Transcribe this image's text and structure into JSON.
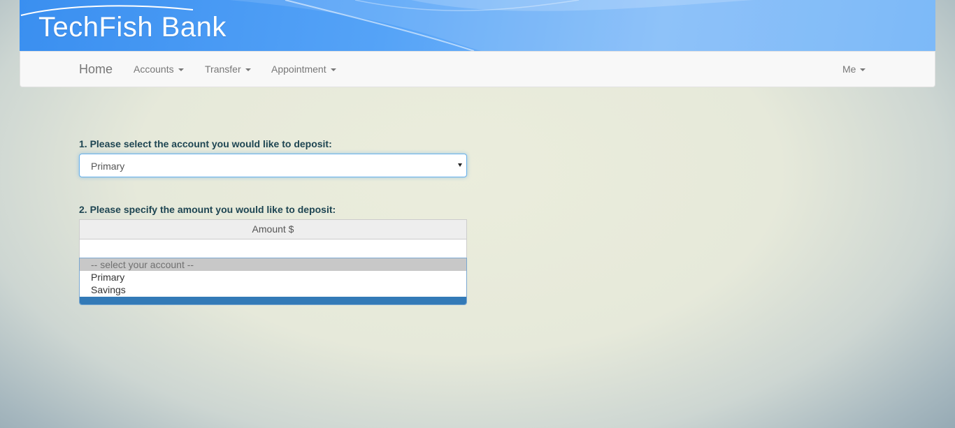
{
  "brand": {
    "name": "TechFish Bank"
  },
  "navbar": {
    "home": "Home",
    "items": [
      {
        "label": "Accounts"
      },
      {
        "label": "Transfer"
      },
      {
        "label": "Appointment"
      }
    ],
    "user": "Me"
  },
  "form": {
    "step1_label": "1. Please select the account you would like to deposit:",
    "account_select": {
      "value": "Primary"
    },
    "step2_label": "2. Please specify the amount you would like to deposit:",
    "amount_addon": "Amount $",
    "amount_value": "",
    "dropdown_options": [
      "-- select your account --",
      "Primary",
      "Savings"
    ]
  },
  "colors": {
    "banner": "#4a98f4",
    "navbar_bg": "#f8f8f8",
    "label_text": "#1e4552",
    "focus_border": "#66afe9",
    "dropdown_footer": "#337ab7"
  },
  "icons": [
    "caret-down-icon",
    "select-arrow-icon"
  ]
}
